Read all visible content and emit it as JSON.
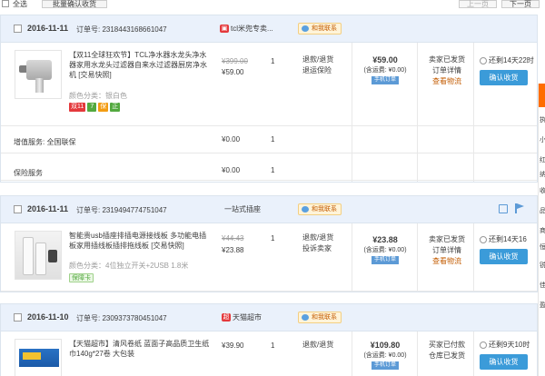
{
  "toolbar": {
    "select_all_label": "全选",
    "batch_confirm_label": "批量确认收货",
    "prev_label": "上一页",
    "next_label": "下一页"
  },
  "colors": {
    "header_bg": "#eaf1fb",
    "accent_blue": "#3b9bd9",
    "logistics_orange": "#c35b00",
    "side_tab_orange": "#ff6d00"
  },
  "orders": [
    {
      "date": "2016-11-11",
      "order_no": "订单号: 2318443168661047",
      "shop": "tcl米兜专卖...",
      "contact": "和我联系",
      "item": {
        "title": "【双11全球狂欢节】TCL净水器水龙头净水器家用水龙头过滤器自来水过滤器厨房净水机 [交易快照]",
        "spec": "颜色分类：银白色",
        "price_orig": "¥399.00",
        "price": "¥59.00",
        "qty": "1",
        "service": [
          "退款/退货",
          "退运保险"
        ],
        "badges": [
          "双11",
          "7",
          "保",
          "正"
        ]
      },
      "extras": [
        {
          "label": "增值服务: 全国联保",
          "price": "¥0.00",
          "qty": "1"
        },
        {
          "label": "保险服务",
          "price": "¥0.00",
          "qty": "1"
        }
      ],
      "total": "¥59.00",
      "total_sub": "(含运费: ¥0.00)",
      "mobile_tag": "手机订单",
      "status": [
        "卖家已发货",
        "订单详情",
        "查看物流"
      ],
      "timer": "还剩14天22时",
      "confirm_label": "确认收货"
    },
    {
      "date": "2016-11-11",
      "order_no": "订单号: 2319494774751047",
      "shop": "一站式插座",
      "contact": "和我联系",
      "item": {
        "title": "智能贵usb插座排插电源接线板 多功能电插板家用插线板插排拖线板 [交易快照]",
        "spec": "颜色分类：4位独立开关+2USB 1.8米",
        "price_orig": "¥44.43",
        "price": "¥23.88",
        "qty": "1",
        "service": [
          "退款/退货",
          "投诉卖家"
        ],
        "badges": [
          "保障卡"
        ]
      },
      "total": "¥23.88",
      "total_sub": "(含运费: ¥0.00)",
      "mobile_tag": "手机订单",
      "status": [
        "卖家已发货",
        "订单详情",
        "查看物流"
      ],
      "timer": "还剩14天16",
      "confirm_label": "确认收货"
    },
    {
      "date": "2016-11-10",
      "order_no": "订单号: 2309373780451047",
      "shop": "天猫超市",
      "contact": "和我联系",
      "item": {
        "title": "【天猫超市】清风卷纸 蓝面子高品质卫生纸巾140g*27卷 大包装",
        "price": "¥39.90",
        "qty": "1",
        "service": [
          "退款/退货"
        ]
      },
      "total": "¥109.80",
      "total_sub": "(含运费: ¥0.00)",
      "mobile_tag": "手机订单",
      "status": [
        "买家已付款",
        "仓库已发货"
      ],
      "timer": "还剩9天10时",
      "confirm_label": "确认收货"
    }
  ],
  "side_panel": {
    "chars": [
      "执",
      "小",
      "红",
      "纳",
      "收",
      "品",
      "商",
      "恒",
      "锐",
      "佳",
      "盈"
    ]
  }
}
